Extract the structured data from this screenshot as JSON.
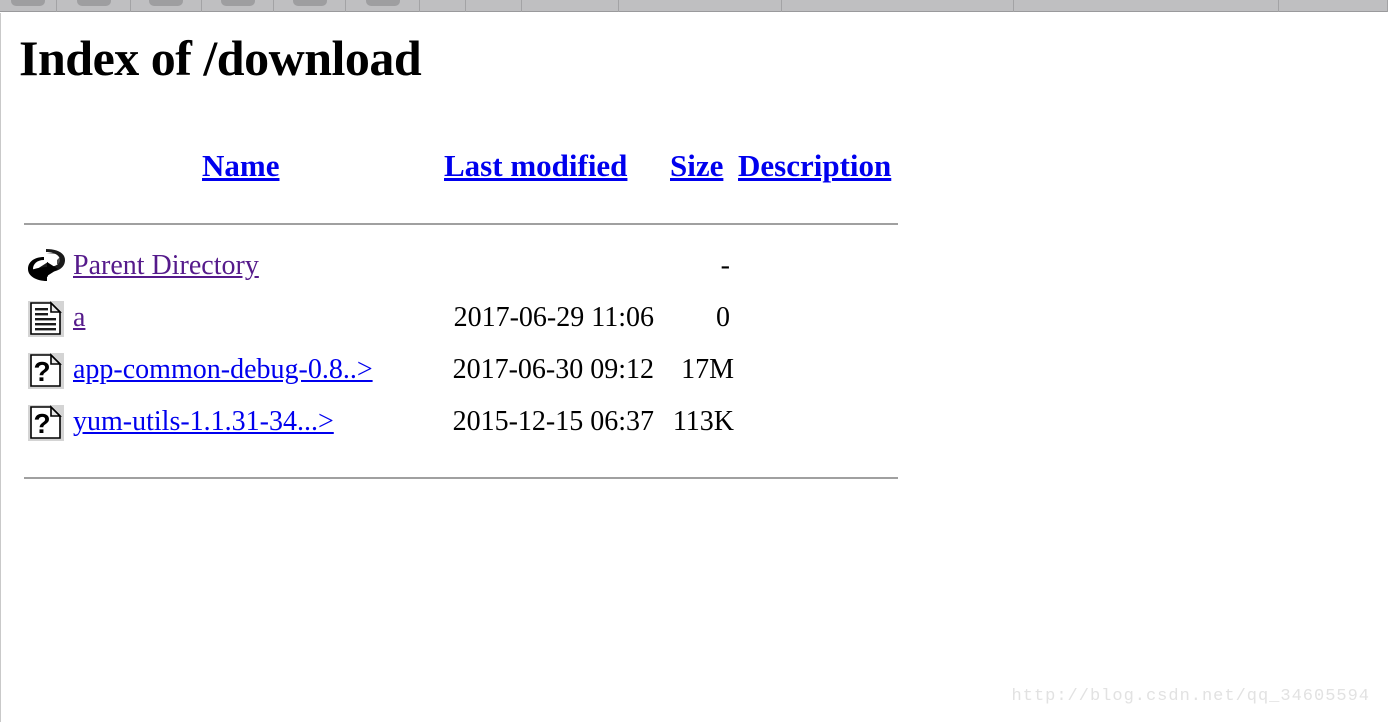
{
  "browser": {
    "toolbar_buttons": 6,
    "empty_cells": 6
  },
  "page": {
    "title": "Index of /download",
    "background": "#ffffff",
    "link_color": "#0000ee",
    "visited_link_color": "#551a8b"
  },
  "table": {
    "headers": {
      "name": "Name",
      "last_modified": "Last modified",
      "size": "Size",
      "description": "Description"
    },
    "rows": [
      {
        "icon": "back-arrow-icon",
        "name": "Parent Directory",
        "link_state": "visited",
        "last_modified": "",
        "size": "-",
        "description": ""
      },
      {
        "icon": "text-file-icon",
        "name": "a",
        "link_state": "visited",
        "last_modified": "2017-06-29 11:06",
        "size": "0",
        "description": ""
      },
      {
        "icon": "unknown-file-icon",
        "name": "app-common-debug-0.8..>",
        "link_state": "unvisited",
        "last_modified": "2017-06-30 09:12",
        "size": "17M",
        "description": ""
      },
      {
        "icon": "unknown-file-icon",
        "name": "yum-utils-1.1.31-34...>",
        "link_state": "unvisited",
        "last_modified": "2015-12-15 06:37",
        "size": "113K",
        "description": ""
      }
    ]
  },
  "watermark": {
    "text": "http://blog.csdn.net/qq_34605594"
  }
}
